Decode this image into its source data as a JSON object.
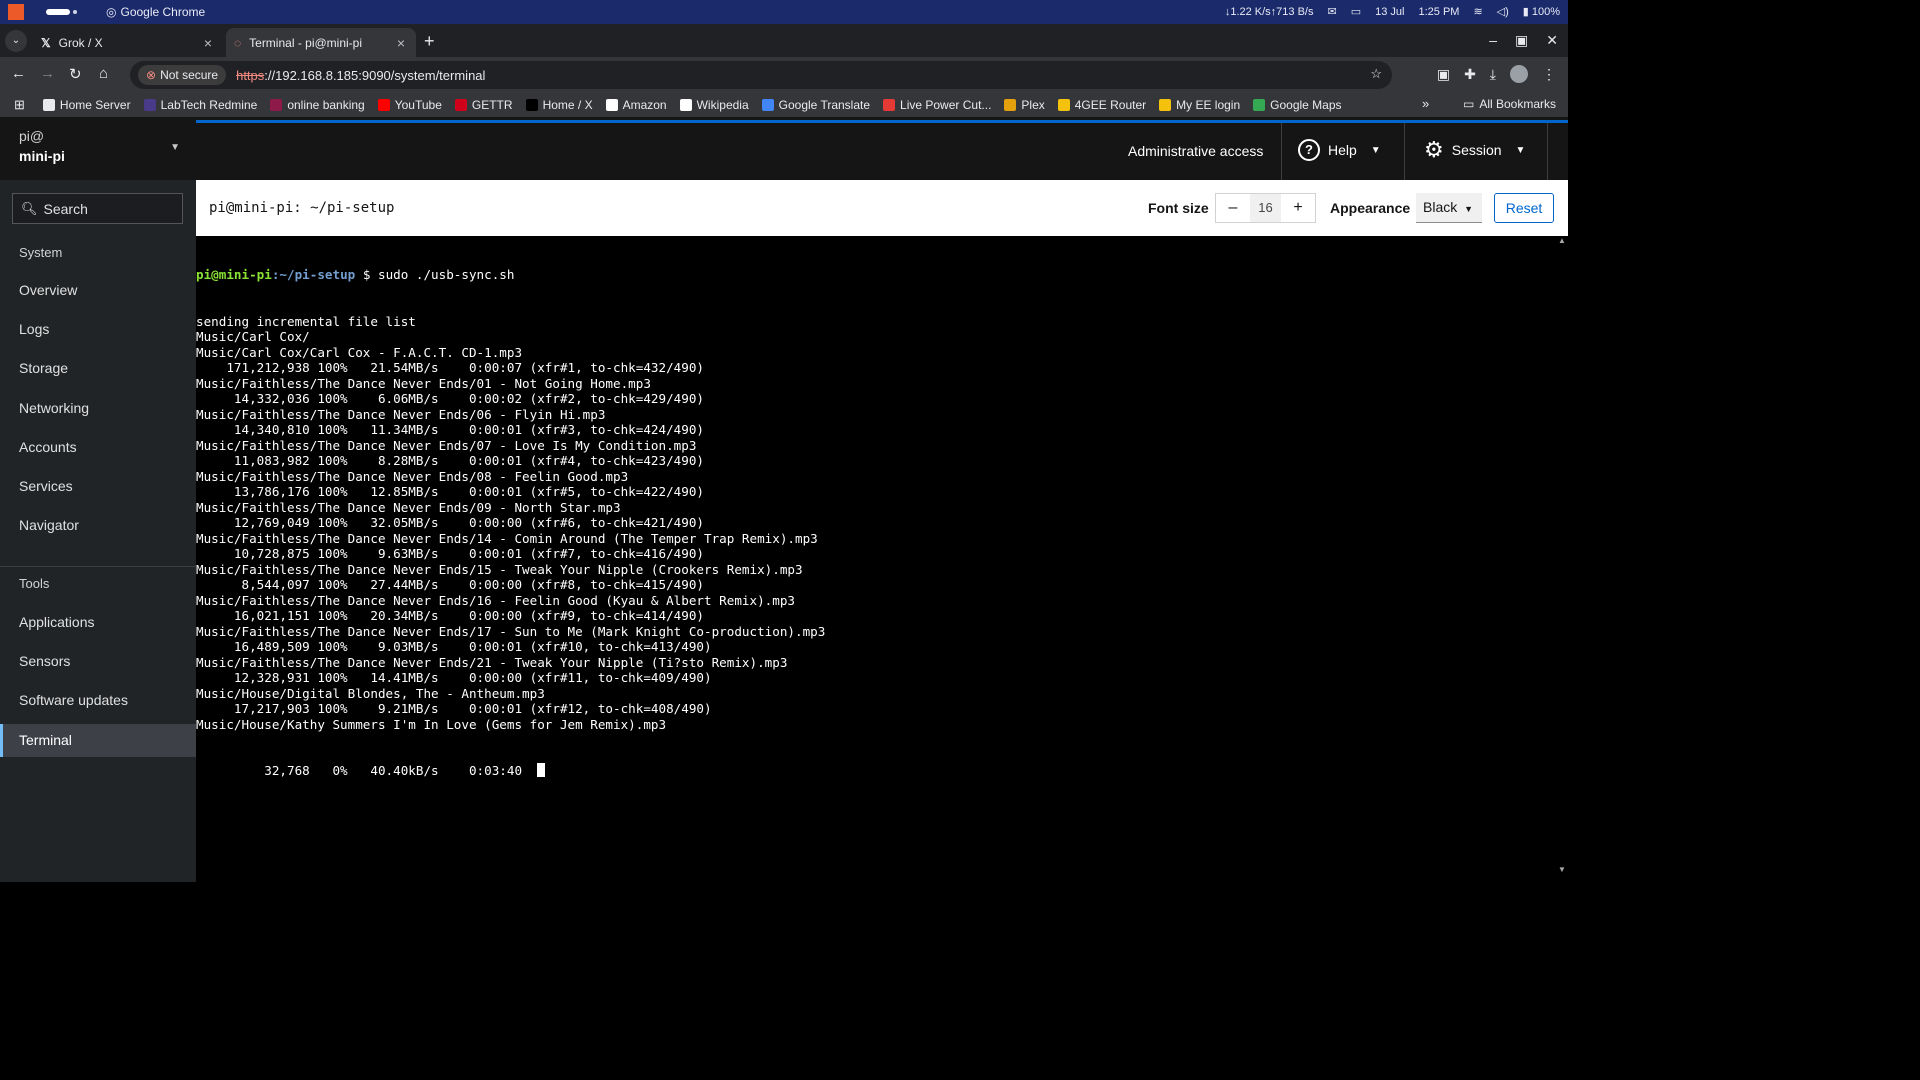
{
  "os_bar": {
    "app_name": "Google Chrome",
    "network": "↓1.22 K/s↑713 B/s",
    "date": "13 Jul",
    "time": "1:25 PM",
    "battery": "100%"
  },
  "tabs": [
    {
      "title": "Grok / X",
      "active": false
    },
    {
      "title": "Terminal - pi@mini-pi",
      "active": true
    }
  ],
  "toolbar": {
    "security_label": "Not secure",
    "url_scheme": "https",
    "url_rest": "://192.168.8.185:9090/system/terminal"
  },
  "bookmarks": [
    {
      "label": "Home Server",
      "color": "#e8eaed"
    },
    {
      "label": "LabTech Redmine",
      "color": "#4a3a8a"
    },
    {
      "label": "online banking",
      "color": "#8e1a4a"
    },
    {
      "label": "YouTube",
      "color": "#ff0000"
    },
    {
      "label": "GETTR",
      "color": "#d0021b"
    },
    {
      "label": "Home / X",
      "color": "#000000"
    },
    {
      "label": "Amazon",
      "color": "#ffffff"
    },
    {
      "label": "Wikipedia",
      "color": "#ffffff"
    },
    {
      "label": "Google Translate",
      "color": "#4285f4"
    },
    {
      "label": "Live Power Cut...",
      "color": "#e53935"
    },
    {
      "label": "Plex",
      "color": "#e5a00d"
    },
    {
      "label": "4GEE Router",
      "color": "#f4c20d"
    },
    {
      "label": "My EE login",
      "color": "#f4c20d"
    },
    {
      "label": "Google Maps",
      "color": "#34a853"
    }
  ],
  "bookmarks_all": "All Bookmarks",
  "sidebar": {
    "user": "pi@",
    "host": "mini-pi",
    "search_placeholder": "Search",
    "system_heading": "System",
    "system_items": [
      "Overview",
      "Logs",
      "Storage",
      "Networking",
      "Accounts",
      "Services",
      "Navigator"
    ],
    "tools_heading": "Tools",
    "tools_items": [
      "Applications",
      "Sensors",
      "Software updates",
      "Terminal"
    ],
    "active": "Terminal"
  },
  "header": {
    "admin": "Administrative access",
    "help": "Help",
    "session": "Session"
  },
  "terminal_toolbar": {
    "title": "pi@mini-pi: ~/pi-setup",
    "font_size_label": "Font size",
    "font_size_value": "16",
    "appearance_label": "Appearance",
    "appearance_value": "Black",
    "reset_label": "Reset"
  },
  "terminal": {
    "prompt_user": "pi@mini-pi",
    "prompt_path": ":~/pi-setup",
    "command": " $ sudo ./usb-sync.sh",
    "lines": [
      "sending incremental file list",
      "Music/Carl Cox/",
      "Music/Carl Cox/Carl Cox - F.A.C.T. CD-1.mp3",
      "    171,212,938 100%   21.54MB/s    0:00:07 (xfr#1, to-chk=432/490)",
      "Music/Faithless/The Dance Never Ends/01 - Not Going Home.mp3",
      "     14,332,036 100%    6.06MB/s    0:00:02 (xfr#2, to-chk=429/490)",
      "Music/Faithless/The Dance Never Ends/06 - Flyin Hi.mp3",
      "     14,340,810 100%   11.34MB/s    0:00:01 (xfr#3, to-chk=424/490)",
      "Music/Faithless/The Dance Never Ends/07 - Love Is My Condition.mp3",
      "     11,083,982 100%    8.28MB/s    0:00:01 (xfr#4, to-chk=423/490)",
      "Music/Faithless/The Dance Never Ends/08 - Feelin Good.mp3",
      "     13,786,176 100%   12.85MB/s    0:00:01 (xfr#5, to-chk=422/490)",
      "Music/Faithless/The Dance Never Ends/09 - North Star.mp3",
      "     12,769,049 100%   32.05MB/s    0:00:00 (xfr#6, to-chk=421/490)",
      "Music/Faithless/The Dance Never Ends/14 - Comin Around (The Temper Trap Remix).mp3",
      "     10,728,875 100%    9.63MB/s    0:00:01 (xfr#7, to-chk=416/490)",
      "Music/Faithless/The Dance Never Ends/15 - Tweak Your Nipple (Crookers Remix).mp3",
      "      8,544,097 100%   27.44MB/s    0:00:00 (xfr#8, to-chk=415/490)",
      "Music/Faithless/The Dance Never Ends/16 - Feelin Good (Kyau & Albert Remix).mp3",
      "     16,021,151 100%   20.34MB/s    0:00:00 (xfr#9, to-chk=414/490)",
      "Music/Faithless/The Dance Never Ends/17 - Sun to Me (Mark Knight Co-production).mp3",
      "     16,489,509 100%    9.03MB/s    0:00:01 (xfr#10, to-chk=413/490)",
      "Music/Faithless/The Dance Never Ends/21 - Tweak Your Nipple (Ti?sto Remix).mp3",
      "     12,328,931 100%   14.41MB/s    0:00:00 (xfr#11, to-chk=409/490)",
      "Music/House/Digital Blondes, The - Antheum.mp3",
      "     17,217,903 100%    9.21MB/s    0:00:01 (xfr#12, to-chk=408/490)",
      "Music/House/Kathy Summers I'm In Love (Gems for Jem Remix).mp3"
    ],
    "last_line": "         32,768   0%   40.40kB/s    0:03:40  "
  },
  "colors": {
    "accent": "#0066cc",
    "prompt_user": "#8ae234",
    "prompt_path": "#729fcf"
  }
}
